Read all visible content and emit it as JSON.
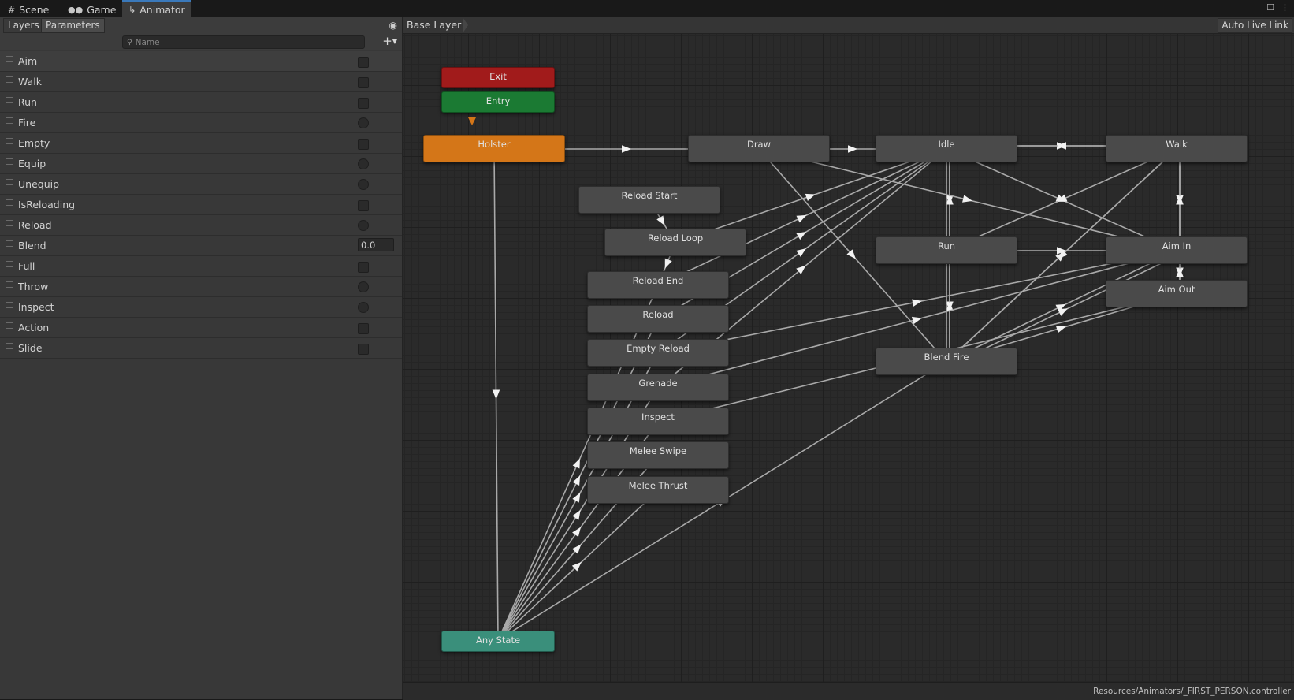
{
  "tabs": [
    {
      "label": "Scene",
      "icon": "grid-icon"
    },
    {
      "label": "Game",
      "icon": "gamepad-icon"
    },
    {
      "label": "Animator",
      "icon": "animator-icon"
    }
  ],
  "left_panel": {
    "subtabs": [
      "Layers",
      "Parameters"
    ],
    "active_subtab": "Parameters",
    "search_placeholder": "Name",
    "parameters": [
      {
        "name": "Aim",
        "type": "bool"
      },
      {
        "name": "Walk",
        "type": "bool"
      },
      {
        "name": "Run",
        "type": "bool"
      },
      {
        "name": "Fire",
        "type": "trigger"
      },
      {
        "name": "Empty",
        "type": "bool"
      },
      {
        "name": "Equip",
        "type": "trigger"
      },
      {
        "name": "Unequip",
        "type": "trigger"
      },
      {
        "name": "IsReloading",
        "type": "bool"
      },
      {
        "name": "Reload",
        "type": "trigger"
      },
      {
        "name": "Blend",
        "type": "float",
        "value": "0.0"
      },
      {
        "name": "Full",
        "type": "bool"
      },
      {
        "name": "Throw",
        "type": "trigger"
      },
      {
        "name": "Inspect",
        "type": "trigger"
      },
      {
        "name": "Action",
        "type": "bool"
      },
      {
        "name": "Slide",
        "type": "bool"
      }
    ]
  },
  "graph": {
    "breadcrumb": "Base Layer",
    "auto_live_link": "Auto Live Link",
    "states": {
      "exit": "Exit",
      "entry": "Entry",
      "holster": "Holster",
      "draw": "Draw",
      "idle": "Idle",
      "walk": "Walk",
      "reload_start": "Reload Start",
      "reload_loop": "Reload Loop",
      "reload_end": "Reload End",
      "reload": "Reload",
      "empty_reload": "Empty Reload",
      "grenade": "Grenade",
      "inspect": "Inspect",
      "melee_swipe": "Melee Swipe",
      "melee_thrust": "Melee Thrust",
      "run": "Run",
      "aim_in": "Aim In",
      "aim_out": "Aim Out",
      "blend_fire": "Blend Fire",
      "any_state": "Any State"
    }
  },
  "status": {
    "path": "Resources/Animators/_FIRST_PERSON.controller"
  },
  "colors": {
    "exit": "#a11b1b",
    "entry": "#1b7a33",
    "default_state": "#d47618",
    "any_state": "#3a8f7b",
    "state": "#4a4a4a",
    "active_tab_underline": "#3a79bb"
  }
}
